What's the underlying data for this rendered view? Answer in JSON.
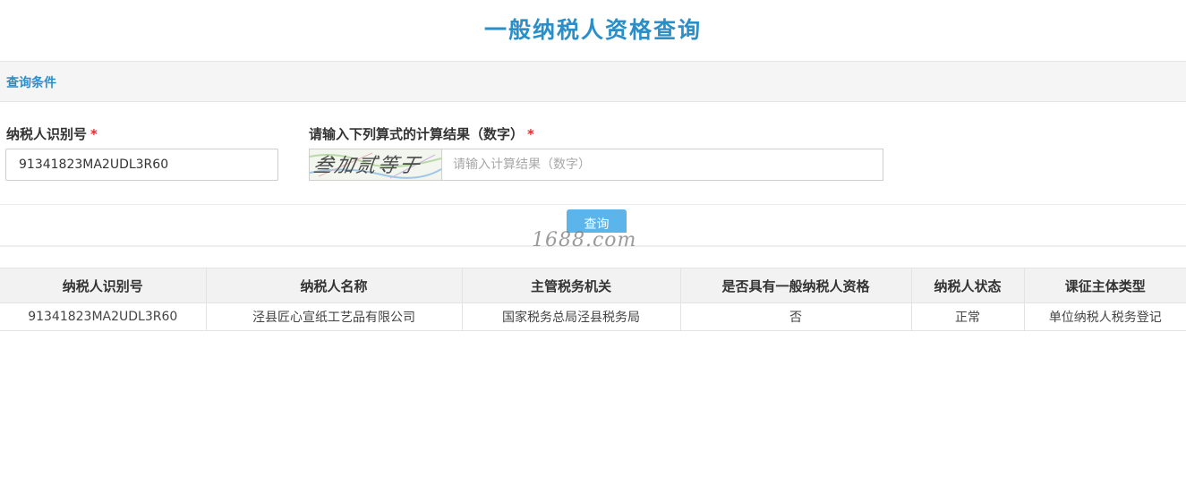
{
  "page": {
    "title": "一般纳税人资格查询"
  },
  "section": {
    "title": "查询条件"
  },
  "form": {
    "tax_id_label": "纳税人识别号",
    "required_mark": "*",
    "tax_id_value": "91341823MA2UDL3R60",
    "captcha_label": "请输入下列算式的计算结果（数字）",
    "captcha_text": "叁加贰等于",
    "captcha_placeholder": "请输入计算结果（数字）",
    "query_button": "查询"
  },
  "watermark": "1688.com",
  "table": {
    "headers": [
      "纳税人识别号",
      "纳税人名称",
      "主管税务机关",
      "是否具有一般纳税人资格",
      "纳税人状态",
      "课征主体类型"
    ],
    "rows": [
      [
        "91341823MA2UDL3R60",
        "泾县匠心宣纸工艺品有限公司",
        "国家税务总局泾县税务局",
        "否",
        "正常",
        "单位纳税人税务登记"
      ]
    ]
  },
  "colors": {
    "accent": "#2a8fc9",
    "button": "#5bb5ea",
    "required": "#d9302c"
  }
}
